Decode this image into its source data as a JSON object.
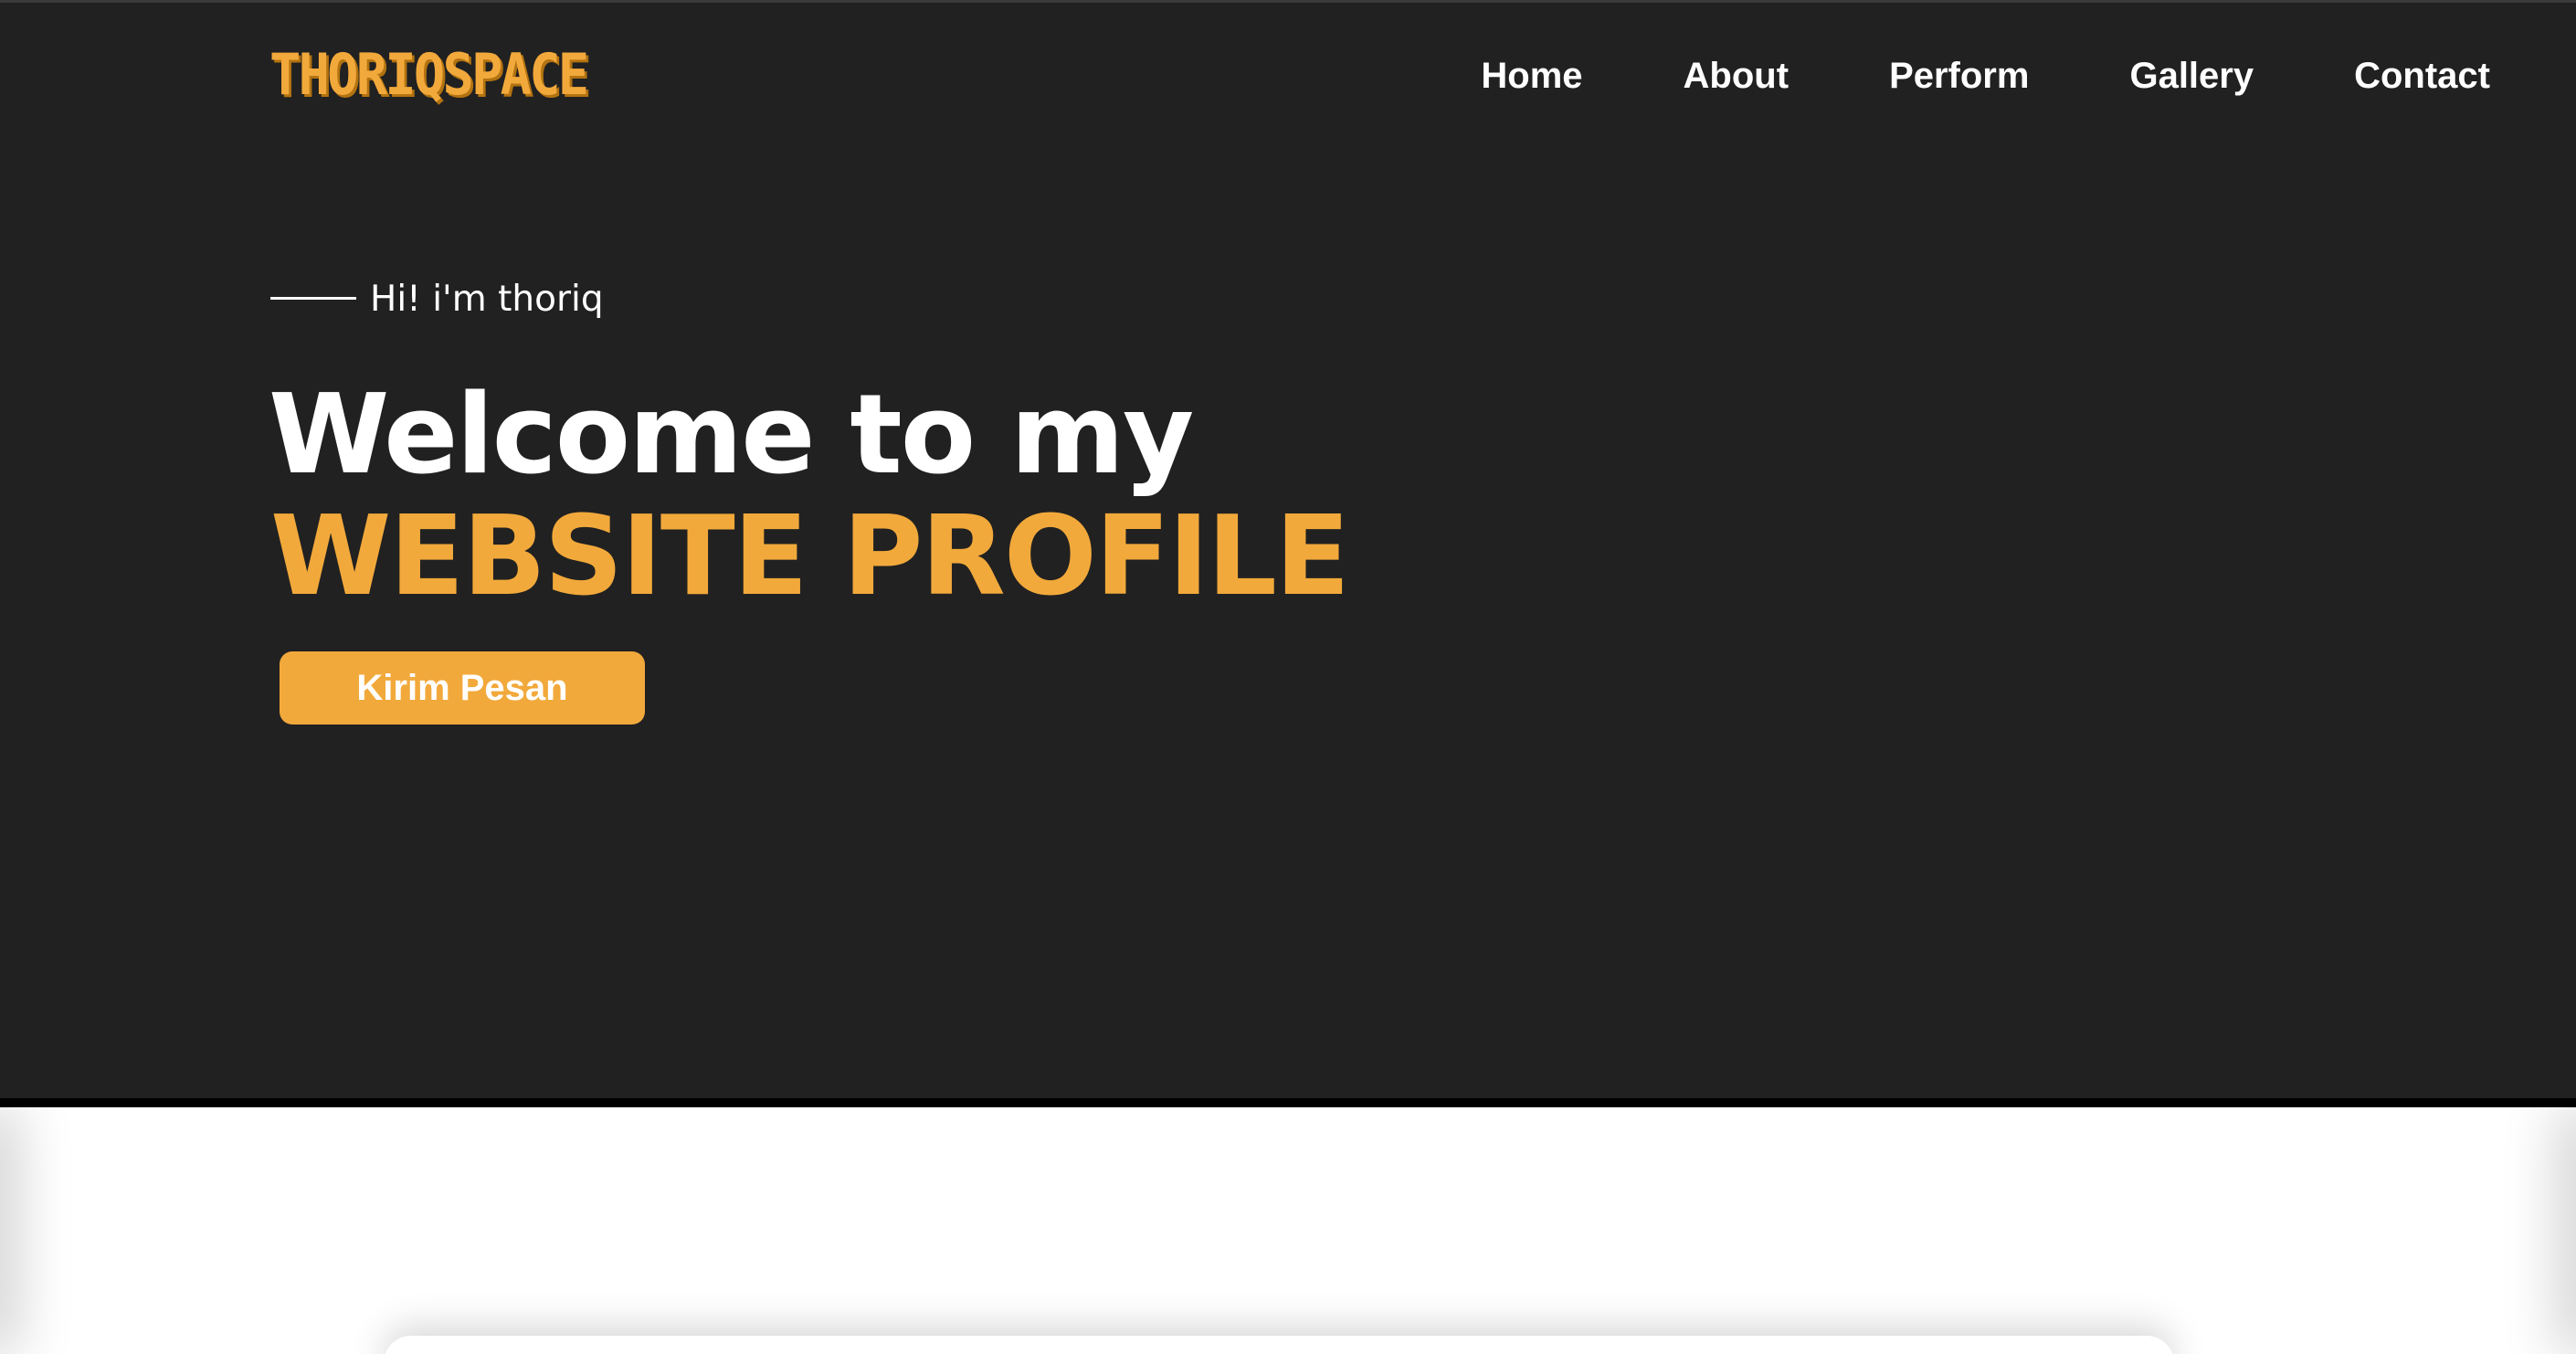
{
  "brand": {
    "logo_text": "THORIQSPACE",
    "accent_color": "#f2a93b",
    "background_color": "#212121"
  },
  "nav": {
    "items": [
      {
        "label": "Home"
      },
      {
        "label": "About"
      },
      {
        "label": "Perform"
      },
      {
        "label": "Gallery"
      },
      {
        "label": "Contact"
      }
    ]
  },
  "hero": {
    "greeting": "Hi! i'm thoriq",
    "headline_line1": "Welcome to my",
    "headline_line2": "WEBSITE PROFILE",
    "cta_label": "Kirim Pesan"
  }
}
